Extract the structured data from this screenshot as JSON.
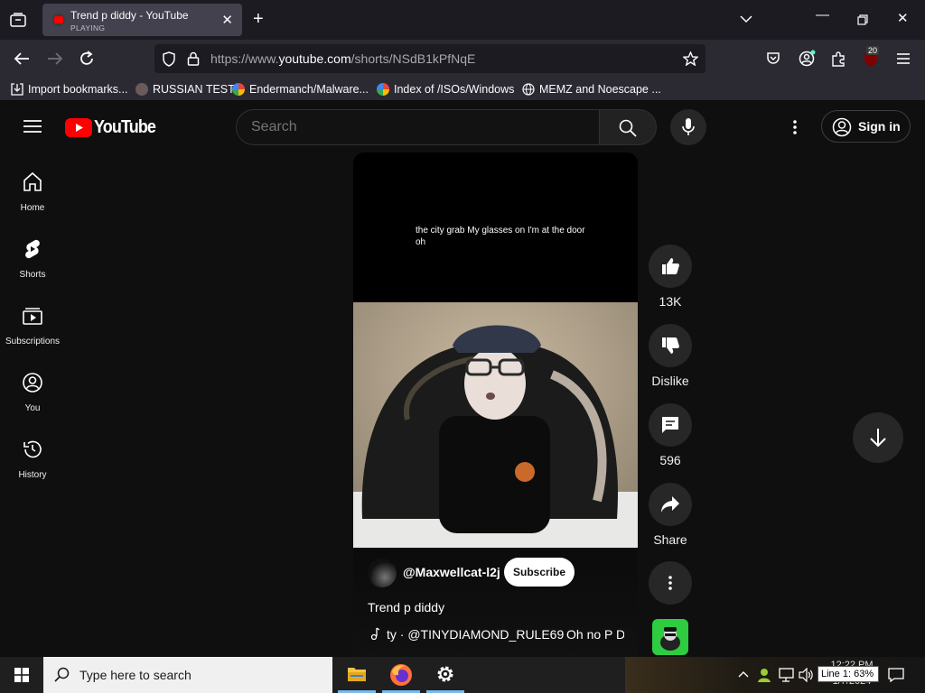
{
  "browser": {
    "tab": {
      "title": "Trend p diddy - YouTube",
      "status": "PLAYING"
    },
    "url": {
      "prefix": "https://www.",
      "host": "youtube.com",
      "path": "/shorts/NSdB1kPfNqE"
    },
    "extensions_badge": "20",
    "bookmarks": [
      {
        "label": "Import bookmarks...",
        "icon": "import-icon"
      },
      {
        "label": "RUSSIAN TEST",
        "icon": "github-icon"
      },
      {
        "label": "Endermanch/Malware...",
        "icon": "google-icon"
      },
      {
        "label": "Index of /ISOs/Windows",
        "icon": "google-icon"
      },
      {
        "label": "MEMZ and Noescape ...",
        "icon": "globe-icon"
      }
    ]
  },
  "youtube": {
    "logo_text": "YouTube",
    "search": {
      "placeholder": "Search"
    },
    "signin_label": "Sign in",
    "nav": [
      {
        "label": "Home",
        "icon": "home-icon"
      },
      {
        "label": "Shorts",
        "icon": "shorts-icon"
      },
      {
        "label": "Subscriptions",
        "icon": "subscriptions-icon"
      },
      {
        "label": "You",
        "icon": "you-icon"
      },
      {
        "label": "History",
        "icon": "history-icon"
      }
    ],
    "short": {
      "caption": "the city grab My glasses on I'm at the door oh",
      "channel": "@Maxwellcat-l2j",
      "subscribe_label": "Subscribe",
      "title": "Trend p diddy",
      "music_credit": "ty · @TINYDIAMOND_RULE69",
      "music_extra": "Oh no P Di"
    },
    "actions": {
      "like_count": "13K",
      "dislike_label": "Dislike",
      "comment_count": "596",
      "share_label": "Share"
    }
  },
  "taskbar": {
    "search_placeholder": "Type here to search",
    "time": "12:22 PM",
    "date": "1/7/2024",
    "line_indicator": "Line 1: 63%"
  },
  "colors": {
    "youtube_red": "#ff0000",
    "page_bg": "#0f0f0f",
    "chrome_bg": "#2b2a33"
  }
}
